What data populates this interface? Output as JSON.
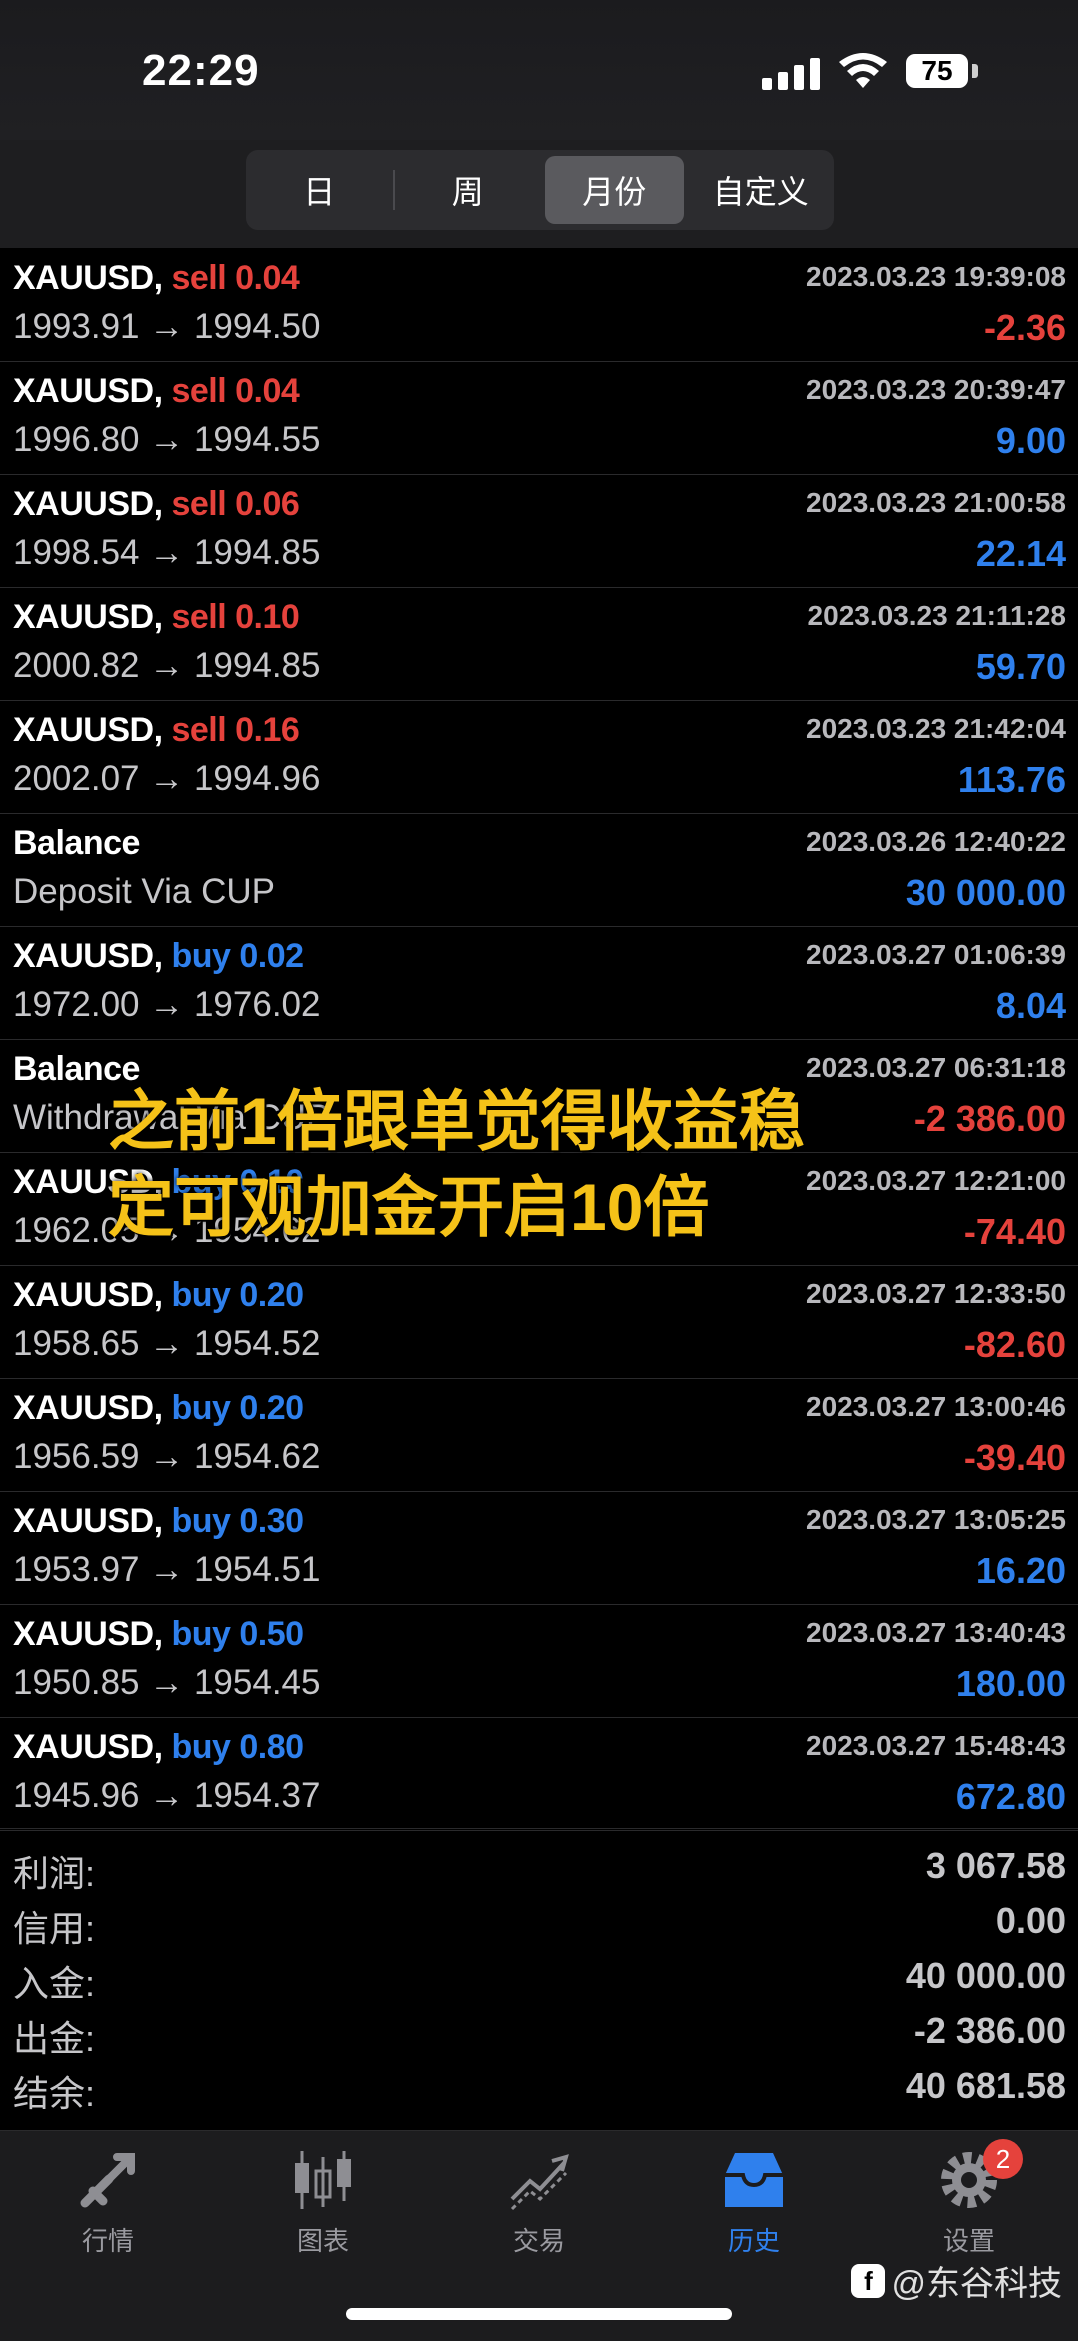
{
  "status": {
    "time": "22:29",
    "battery": "75"
  },
  "period_tabs": [
    {
      "label": "日",
      "active": false
    },
    {
      "label": "周",
      "active": false
    },
    {
      "label": "月份",
      "active": true
    },
    {
      "label": "自定义",
      "active": false
    }
  ],
  "rows": [
    {
      "symbol": "XAUUSD,",
      "side": "sell",
      "side_text": "sell 0.04",
      "date": "2023.03.23 19:39:08",
      "detail": "1993.91 → 1994.50",
      "amount": "-2.36",
      "sign": "neg"
    },
    {
      "symbol": "XAUUSD,",
      "side": "sell",
      "side_text": "sell 0.04",
      "date": "2023.03.23 20:39:47",
      "detail": "1996.80 → 1994.55",
      "amount": "9.00",
      "sign": "pos"
    },
    {
      "symbol": "XAUUSD,",
      "side": "sell",
      "side_text": "sell 0.06",
      "date": "2023.03.23 21:00:58",
      "detail": "1998.54 → 1994.85",
      "amount": "22.14",
      "sign": "pos"
    },
    {
      "symbol": "XAUUSD,",
      "side": "sell",
      "side_text": "sell 0.10",
      "date": "2023.03.23 21:11:28",
      "detail": "2000.82 → 1994.85",
      "amount": "59.70",
      "sign": "pos"
    },
    {
      "symbol": "XAUUSD,",
      "side": "sell",
      "side_text": "sell 0.16",
      "date": "2023.03.23 21:42:04",
      "detail": "2002.07 → 1994.96",
      "amount": "113.76",
      "sign": "pos"
    },
    {
      "symbol": "Balance",
      "side": "none",
      "side_text": "",
      "date": "2023.03.26 12:40:22",
      "detail": "Deposit Via CUP",
      "amount": "30 000.00",
      "sign": "pos"
    },
    {
      "symbol": "XAUUSD,",
      "side": "buy",
      "side_text": "buy 0.02",
      "date": "2023.03.27 01:06:39",
      "detail": "1972.00 → 1976.02",
      "amount": "8.04",
      "sign": "pos"
    },
    {
      "symbol": "Balance",
      "side": "none",
      "side_text": "",
      "date": "2023.03.27 06:31:18",
      "detail": "Withdrawal Via CUP",
      "amount": "-2 386.00",
      "sign": "neg"
    },
    {
      "symbol": "XAUUSD,",
      "side": "buy",
      "side_text": "buy 0.10",
      "date": "2023.03.27 12:21:00",
      "detail": "1962.05 → 1954.62",
      "amount": "-74.40",
      "sign": "neg"
    },
    {
      "symbol": "XAUUSD,",
      "side": "buy",
      "side_text": "buy 0.20",
      "date": "2023.03.27 12:33:50",
      "detail": "1958.65 → 1954.52",
      "amount": "-82.60",
      "sign": "neg"
    },
    {
      "symbol": "XAUUSD,",
      "side": "buy",
      "side_text": "buy 0.20",
      "date": "2023.03.27 13:00:46",
      "detail": "1956.59 → 1954.62",
      "amount": "-39.40",
      "sign": "neg"
    },
    {
      "symbol": "XAUUSD,",
      "side": "buy",
      "side_text": "buy 0.30",
      "date": "2023.03.27 13:05:25",
      "detail": "1953.97 → 1954.51",
      "amount": "16.20",
      "sign": "pos"
    },
    {
      "symbol": "XAUUSD,",
      "side": "buy",
      "side_text": "buy 0.50",
      "date": "2023.03.27 13:40:43",
      "detail": "1950.85 → 1954.45",
      "amount": "180.00",
      "sign": "pos"
    },
    {
      "symbol": "XAUUSD,",
      "side": "buy",
      "side_text": "buy 0.80",
      "date": "2023.03.27 15:48:43",
      "detail": "1945.96 → 1954.37",
      "amount": "672.80",
      "sign": "pos"
    }
  ],
  "summary": [
    {
      "label": "利润:",
      "value": "3 067.58"
    },
    {
      "label": "信用:",
      "value": "0.00"
    },
    {
      "label": "入金:",
      "value": "40 000.00"
    },
    {
      "label": "出金:",
      "value": "-2 386.00"
    },
    {
      "label": "结余:",
      "value": "40 681.58"
    }
  ],
  "overlay_caption": {
    "line1": "之前1倍跟单觉得收益稳",
    "line2": "定可观加金开启10倍"
  },
  "tabbar": [
    {
      "label": "行情",
      "icon": "quotes-icon",
      "active": false
    },
    {
      "label": "图表",
      "icon": "chart-icon",
      "active": false
    },
    {
      "label": "交易",
      "icon": "trade-icon",
      "active": false
    },
    {
      "label": "历史",
      "icon": "history-icon",
      "active": true
    },
    {
      "label": "设置",
      "icon": "gear-icon",
      "active": false,
      "badge": "2"
    }
  ],
  "watermark": "@东谷科技",
  "colors": {
    "sell": "#e5423c",
    "buy": "#2f80ed",
    "accent": "#2f80ed",
    "caption": "#f5c218"
  }
}
